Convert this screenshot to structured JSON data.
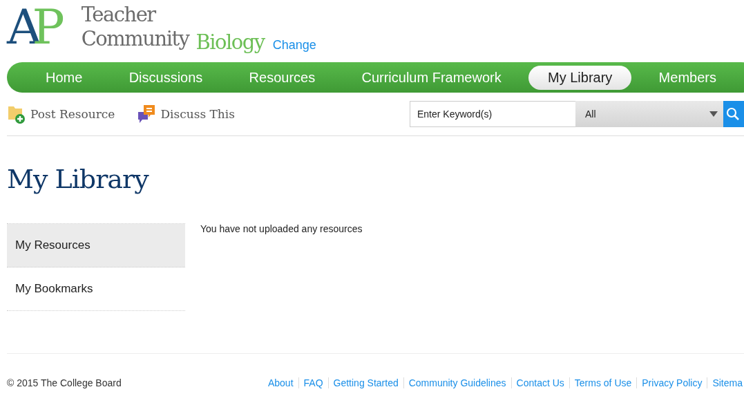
{
  "logo": {
    "letter_a": "A",
    "letter_p": "P",
    "line_1": "Teacher",
    "line_2": "Community",
    "subject": "Biology",
    "change_link": "Change"
  },
  "nav": [
    {
      "label": "Home",
      "selected": false
    },
    {
      "label": "Discussions",
      "selected": false
    },
    {
      "label": "Resources",
      "selected": false
    },
    {
      "label": "Curriculum Framework",
      "selected": false
    },
    {
      "label": "My Library",
      "selected": true
    },
    {
      "label": "Members",
      "selected": false
    }
  ],
  "toolbar": {
    "actions": [
      {
        "label": "Post Resource",
        "kind": "post"
      },
      {
        "label": "Discuss This",
        "kind": "discuss"
      }
    ],
    "search": {
      "placeholder": "Enter Keyword(s)",
      "category": "All"
    }
  },
  "page_title": "My Library",
  "sidebar": [
    {
      "label": "My Resources",
      "selected": true
    },
    {
      "label": "My Bookmarks",
      "selected": false
    }
  ],
  "message": "You have not uploaded any resources",
  "footer": {
    "copyright": "© 2015 The College Board",
    "links": [
      "About",
      "FAQ",
      "Getting Started",
      "Community Guidelines",
      "Contact Us",
      "Terms of Use",
      "Privacy Policy",
      "Sitema"
    ]
  }
}
